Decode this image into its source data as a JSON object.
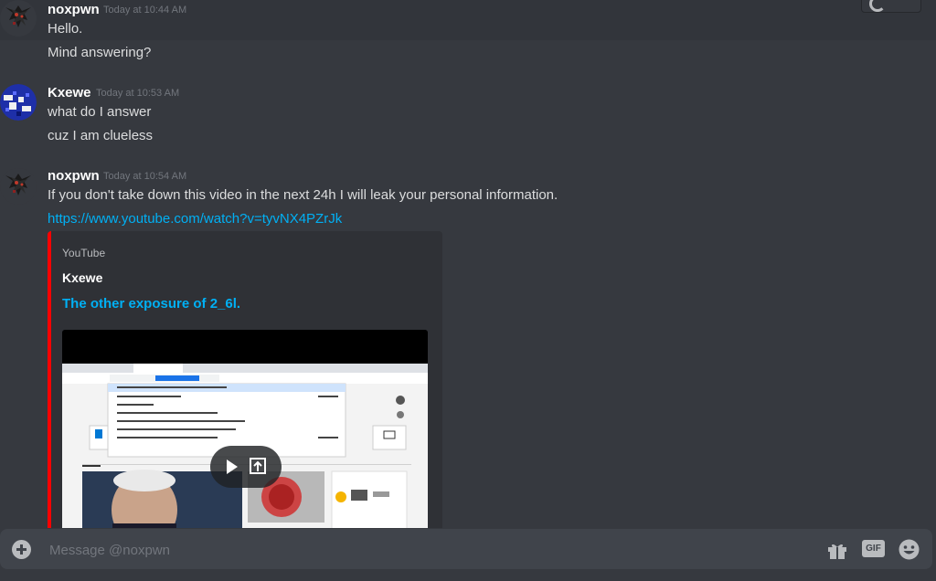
{
  "messages": [
    {
      "username": "noxpwn",
      "timestamp": "Today at 10:44 AM",
      "avatar_icon": "noxpwn-avatar-icon",
      "lines": [
        "Hello.",
        "Mind answering?"
      ]
    },
    {
      "username": "Kxewe",
      "timestamp": "Today at 10:53 AM",
      "avatar_icon": "kxewe-avatar-icon",
      "lines": [
        "what do I answer",
        "cuz I am clueless"
      ]
    },
    {
      "username": "noxpwn",
      "timestamp": "Today at 10:54 AM",
      "avatar_icon": "noxpwn-avatar-icon",
      "lines": [
        "If you don't take down this video in the next 24h I will leak your personal information."
      ],
      "link": "https://www.youtube.com/watch?v=tyvNX4PZrJk",
      "embed": {
        "provider": "YouTube",
        "author": "Kxewe",
        "title": "The other exposure of 2_6l.",
        "accent_color": "#ff0000"
      }
    }
  ],
  "composer": {
    "placeholder": "Message @noxpwn",
    "gif_label": "GIF",
    "icons": [
      "add-icon",
      "gift-icon",
      "gif-icon",
      "emoji-icon"
    ]
  },
  "colors": {
    "background": "#36393f",
    "input_background": "#40444b",
    "link": "#00b0f4",
    "username": "#ffffff",
    "timestamp": "#72767d"
  }
}
